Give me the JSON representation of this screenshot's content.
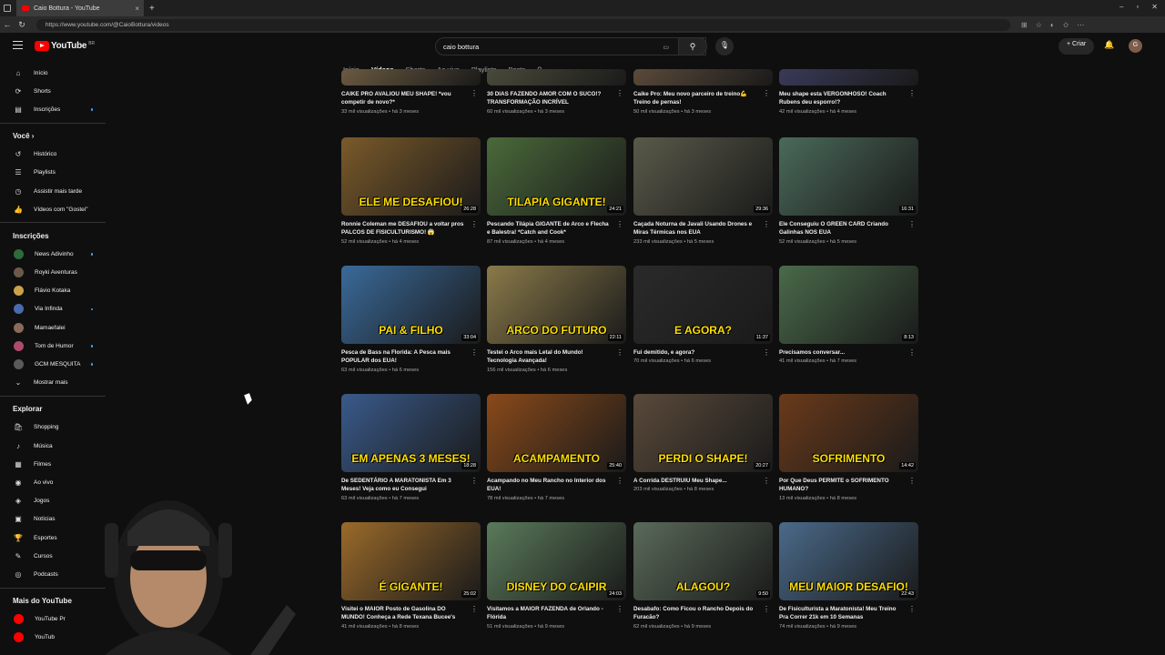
{
  "browser": {
    "tab_title": "Caio Bottura - YouTube",
    "tab_close": "×",
    "new_tab": "+",
    "url": "https://www.youtube.com/@CaioBottura/videos",
    "win_min": "–",
    "win_max": "▫",
    "win_close": "✕"
  },
  "header": {
    "logo": "YouTube",
    "country": "BR",
    "search_value": "caio bottura",
    "clear": "✕",
    "create_label": "Criar",
    "avatar_letter": "G"
  },
  "sidebar": {
    "main": [
      {
        "label": "Início",
        "icon": "home-icon",
        "glyph": "⌂"
      },
      {
        "label": "Shorts",
        "icon": "shorts-icon",
        "glyph": "⟳"
      },
      {
        "label": "Inscrições",
        "icon": "subscriptions-icon",
        "glyph": "▤"
      }
    ],
    "you_title": "Você",
    "you": [
      {
        "label": "Histórico",
        "icon": "history-icon",
        "glyph": "↺"
      },
      {
        "label": "Playlists",
        "icon": "playlists-icon",
        "glyph": "☰"
      },
      {
        "label": "Assistir mais tarde",
        "icon": "watch-later-icon",
        "glyph": "◷"
      },
      {
        "label": "Vídeos com \"Gostei\"",
        "icon": "like-icon",
        "glyph": "👍"
      }
    ],
    "subs_title": "Inscrições",
    "subs": [
      {
        "label": "News Adivinho",
        "color": "#2e6b3a"
      },
      {
        "label": "Royki Aventuras",
        "color": "#6b5a4a"
      },
      {
        "label": "Flávio Kotaka",
        "color": "#c9a24a"
      },
      {
        "label": "Via Infinda",
        "color": "#4a6ab0"
      },
      {
        "label": "Mamaefalei",
        "color": "#8a6a5a"
      },
      {
        "label": "Tom de Humor",
        "color": "#b04a6a"
      },
      {
        "label": "GCM MESQUITA",
        "color": "#5a5a5a"
      }
    ],
    "show_more": "Mostrar mais",
    "explore_title": "Explorar",
    "explore": [
      {
        "label": "Shopping",
        "icon": "shopping-icon",
        "glyph": "🛍"
      },
      {
        "label": "Música",
        "icon": "music-icon",
        "glyph": "♪"
      },
      {
        "label": "Filmes",
        "icon": "movies-icon",
        "glyph": "▦"
      },
      {
        "label": "Ao vivo",
        "icon": "live-icon",
        "glyph": "◉"
      },
      {
        "label": "Jogos",
        "icon": "gaming-icon",
        "glyph": "◈"
      },
      {
        "label": "Notícias",
        "icon": "news-icon",
        "glyph": "▣"
      },
      {
        "label": "Esportes",
        "icon": "sports-icon",
        "glyph": "🏆"
      },
      {
        "label": "Cursos",
        "icon": "courses-icon",
        "glyph": "✎"
      },
      {
        "label": "Podcasts",
        "icon": "podcasts-icon",
        "glyph": "◎"
      }
    ],
    "more_title": "Mais do YouTube",
    "more": [
      {
        "label": "YouTube Pr",
        "color": "#ff0000"
      },
      {
        "label": "YouTub",
        "color": "#ff0000"
      }
    ]
  },
  "channel_tabs": [
    "Início",
    "Vídeos",
    "Shorts",
    "Ao vivo",
    "Playlists",
    "Posts"
  ],
  "videos": [
    {
      "title": "CAIKE PRO AVALIOU MEU SHAPE! *vou competir de novo?*",
      "meta": "33 mil visualizações • há 3 meses",
      "color": "#6a5a40",
      "duration": "",
      "overlay": ""
    },
    {
      "title": "30 DIAS FAZENDO AMOR COM O SUCO!? TRANSFORMAÇÃO INCRÍVEL",
      "meta": "60 mil visualizações • há 3 meses",
      "color": "#4a4a3a",
      "duration": "",
      "overlay": ""
    },
    {
      "title": "Caike Pro: Meu novo parceiro de treino💪 Treino de pernas!",
      "meta": "50 mil visualizações • há 3 meses",
      "color": "#5a4a3a",
      "duration": "",
      "overlay": ""
    },
    {
      "title": "Meu shape esta VERGONHOSO! Coach Rubens deu esporro!?",
      "meta": "42 mil visualizações • há 4 meses",
      "color": "#3a3a5a",
      "duration": "",
      "overlay": ""
    },
    {
      "title": "Ronnie Coleman me DESAFIOU a voltar pros PALCOS DE FISICULTURISMO! 😱",
      "meta": "52 mil visualizações • há 4 meses",
      "color": "#7a5a2a",
      "duration": "26:28",
      "overlay": "ELE ME DESAFIOU!"
    },
    {
      "title": "Pescando Tilápia GIGANTE de Arco e Flecha e Balestra! *Catch and Cook*",
      "meta": "87 mil visualizações • há 4 meses",
      "color": "#4a6a3a",
      "duration": "24:21",
      "overlay": "TILAPIA GIGANTE!"
    },
    {
      "title": "Caçada Noturna de Javali Usando Drones e Miras Térmicas nos EUA",
      "meta": "233 mil visualizações • há 5 meses",
      "color": "#5a5a4a",
      "duration": "29:36",
      "overlay": ""
    },
    {
      "title": "Ele Conseguiu O GREEN CARD Criando Galinhas NOS EUA",
      "meta": "52 mil visualizações • há 5 meses",
      "color": "#4a6a5a",
      "duration": "16:31",
      "overlay": ""
    },
    {
      "title": "Pesca de Bass na Florida: A Pesca mais POPULAR dos EUA!",
      "meta": "63 mil visualizações • há 6 meses",
      "color": "#3a6a9a",
      "duration": "33:04",
      "overlay": "PAI & FILHO"
    },
    {
      "title": "Testei o Arco mais Letal do Mundo! Tecnologia Avançada!",
      "meta": "156 mil visualizações • há 6 meses",
      "color": "#8a7a4a",
      "duration": "22:11",
      "overlay": "ARCO DO FUTURO"
    },
    {
      "title": "Fui demitido, e agora?",
      "meta": "70 mil visualizações • há 6 meses",
      "color": "#2a2a2a",
      "duration": "11:37",
      "overlay": "E AGORA?"
    },
    {
      "title": "Precisamos conversar...",
      "meta": "41 mil visualizações • há 7 meses",
      "color": "#4a6a4a",
      "duration": "8:13",
      "overlay": ""
    },
    {
      "title": "De SEDENTÁRIO A MARATONISTA Em 3 Meses! Veja como eu Consegui",
      "meta": "63 mil visualizações • há 7 meses",
      "color": "#3a5a8a",
      "duration": "18:28",
      "overlay": "EM APENAS 3 MESES!"
    },
    {
      "title": "Acampando no Meu Rancho no Interior dos EUA!",
      "meta": "78 mil visualizações • há 7 meses",
      "color": "#8a4a1a",
      "duration": "25:40",
      "overlay": "ACAMPAMENTO"
    },
    {
      "title": "A Corrida DESTRUIU Meu Shape...",
      "meta": "203 mil visualizações • há 8 meses",
      "color": "#5a4a3a",
      "duration": "20:27",
      "overlay": "PERDI O SHAPE!"
    },
    {
      "title": "Por Que Deus PERMITE o SOFRIMENTO HUMANO?",
      "meta": "13 mil visualizações • há 8 meses",
      "color": "#6a3a1a",
      "duration": "14:42",
      "overlay": "SOFRIMENTO"
    },
    {
      "title": "Visitei o MAIOR Posto de Gasolina DO MUNDO! Conheça a Rede Texana Bucee's",
      "meta": "41 mil visualizações • há 8 meses",
      "color": "#9a6a2a",
      "duration": "25:02",
      "overlay": "É GIGANTE!"
    },
    {
      "title": "Visitamos a MAIOR FAZENDA de Orlando - Flórida",
      "meta": "51 mil visualizações • há 9 meses",
      "color": "#5a7a5a",
      "duration": "24:03",
      "overlay": "DISNEY DO CAIPIR"
    },
    {
      "title": "Desabafo: Como Ficou o Rancho Depois do Furacão?",
      "meta": "62 mil visualizações • há 9 meses",
      "color": "#5a6a5a",
      "duration": "9:50",
      "overlay": "ALAGOU?"
    },
    {
      "title": "De Fisiculturista a Maratonista! Meu Treino Pra Correr 21k em 10 Semanas",
      "meta": "74 mil visualizações • há 9 meses",
      "color": "#4a6a8a",
      "duration": "22:43",
      "overlay": "MEU MAIOR DESAFIO!"
    }
  ]
}
